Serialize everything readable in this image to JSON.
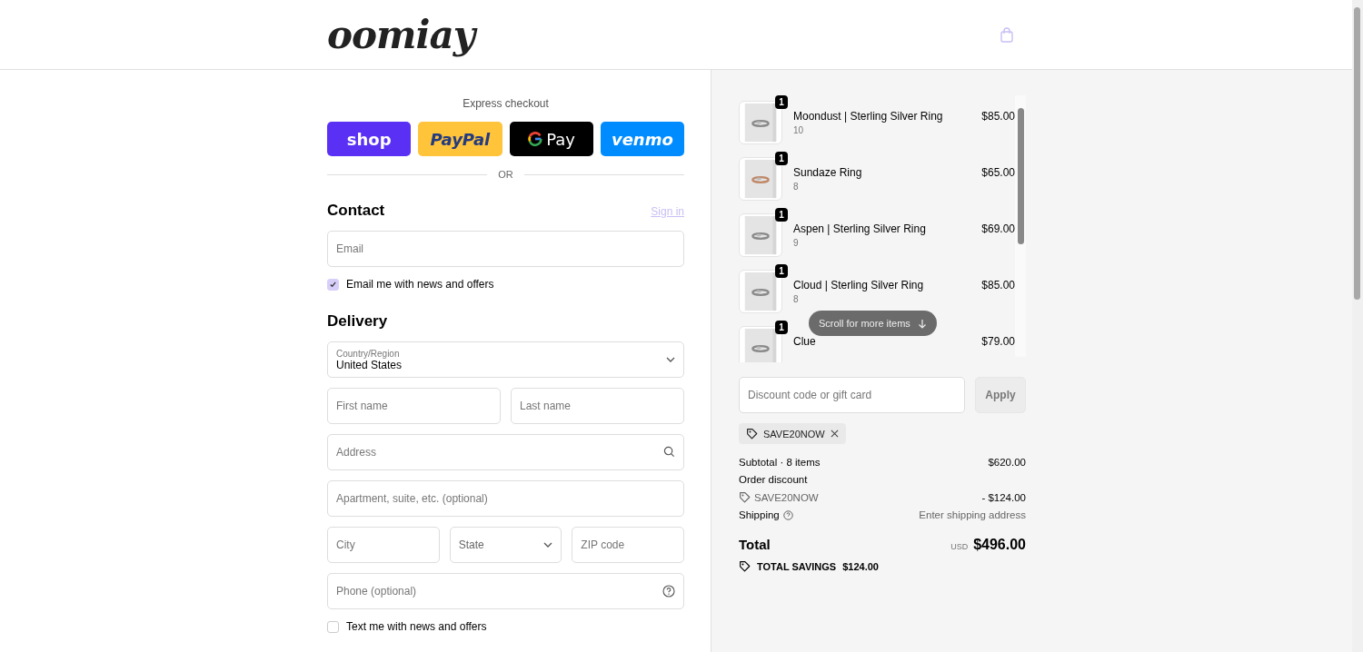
{
  "header": {
    "logo": "oomiay"
  },
  "express": {
    "title": "Express checkout",
    "buttons": [
      {
        "kind": "shop",
        "label": "shop"
      },
      {
        "kind": "paypal",
        "label": "PayPal"
      },
      {
        "kind": "gpay",
        "label": "Pay"
      },
      {
        "kind": "venmo",
        "label": "venmo"
      }
    ],
    "divider": "OR"
  },
  "contact": {
    "heading": "Contact",
    "sign_in": "Sign in",
    "email": {
      "placeholder": "Email"
    },
    "news": {
      "label": "Email me with news and offers",
      "checked": true
    }
  },
  "delivery": {
    "heading": "Delivery",
    "country": {
      "label": "Country/Region",
      "value": "United States"
    },
    "fields": [
      [
        {
          "kind": "input",
          "placeholder": "First name"
        },
        {
          "kind": "input",
          "placeholder": "Last name"
        }
      ],
      [
        {
          "kind": "search",
          "placeholder": "Address"
        }
      ],
      [
        {
          "kind": "input",
          "placeholder": "Apartment, suite, etc. (optional)"
        }
      ],
      [
        {
          "kind": "input",
          "placeholder": "City"
        },
        {
          "kind": "select",
          "placeholder": "State"
        },
        {
          "kind": "input",
          "placeholder": "ZIP code"
        }
      ],
      [
        {
          "kind": "help",
          "placeholder": "Phone (optional)"
        }
      ]
    ],
    "sms": {
      "label": "Text me with news and offers",
      "checked": false
    }
  },
  "cart": {
    "items": [
      {
        "quantity": "1",
        "name": "Moondust | Sterling Silver Ring",
        "variant": "10",
        "price": "$85.00"
      },
      {
        "quantity": "1",
        "name": "Sundaze Ring",
        "variant": "8",
        "price": "$65.00"
      },
      {
        "quantity": "1",
        "name": "Aspen | Sterling Silver Ring",
        "variant": "9",
        "price": "$69.00"
      },
      {
        "quantity": "1",
        "name": "Cloud | Sterling Silver Ring",
        "variant": "8",
        "price": "$85.00"
      },
      {
        "quantity": "1",
        "name": "Clue",
        "price": "$79.00"
      }
    ],
    "scroll_hint": "Scroll for more items",
    "discount": {
      "placeholder": "Discount code or gift card",
      "button": "Apply"
    },
    "applied_code": "SAVE20NOW",
    "subtotal": {
      "label": "Subtotal · 8 items",
      "value": "$620.00"
    },
    "order_discount": {
      "label": "Order discount",
      "code": "SAVE20NOW",
      "value": "- $124.00"
    },
    "shipping": {
      "label": "Shipping",
      "value": "Enter shipping address"
    },
    "total": {
      "label": "Total",
      "currency": "USD",
      "value": "$496.00"
    },
    "savings": {
      "label": "TOTAL SAVINGS",
      "value": "$124.00"
    }
  }
}
